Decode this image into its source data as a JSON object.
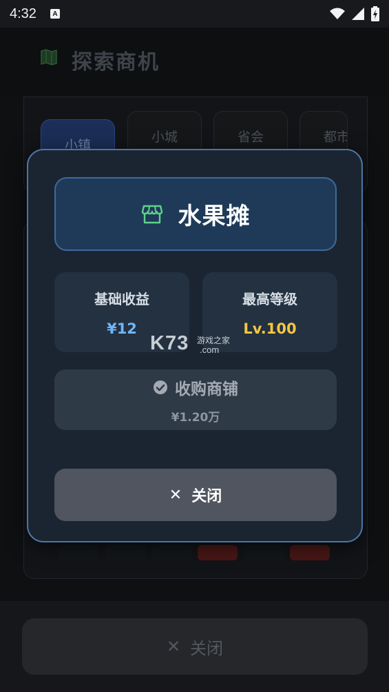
{
  "status_bar": {
    "time": "4:32",
    "notification_letter": "A"
  },
  "background": {
    "title": "探索商机",
    "tabs": [
      {
        "label": "小镇",
        "active": true
      },
      {
        "label": "小城",
        "active": false
      },
      {
        "label": "省会",
        "active": false
      },
      {
        "label": "都市",
        "active": false
      }
    ],
    "close_label": "关闭"
  },
  "modal": {
    "shop_name": "水果摊",
    "stats": [
      {
        "label": "基础收益",
        "value": "¥12",
        "color": "#6fb6ff"
      },
      {
        "label": "最高等级",
        "value": "Lv.100",
        "color": "#f5c542"
      }
    ],
    "buy_label": "收购商铺",
    "buy_price": "¥1.20万",
    "close_label": "关闭"
  },
  "watermark": {
    "brand": "K73",
    "tagline": "游戏之家",
    "domain": ".com"
  },
  "colors": {
    "accent_green": "#5fd38a",
    "accent_blue": "#6fb6ff",
    "accent_gold": "#f5c542"
  }
}
